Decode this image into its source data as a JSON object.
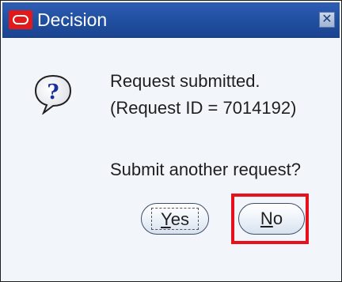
{
  "window": {
    "title": "Decision",
    "close_label": "✕"
  },
  "message": {
    "line1": "Request submitted.",
    "line2": "(Request ID = 7014192)",
    "line3": "Submit another request?"
  },
  "buttons": {
    "yes": {
      "mnemonic": "Y",
      "rest": "es"
    },
    "no": {
      "mnemonic": "N",
      "rest": "o"
    }
  },
  "icons": {
    "app": "oracle-logo-icon",
    "message": "question-icon",
    "close": "close-icon"
  },
  "colors": {
    "titlebar": "#204e9f",
    "highlight": "#e8101b",
    "logo": "#e2191b"
  }
}
